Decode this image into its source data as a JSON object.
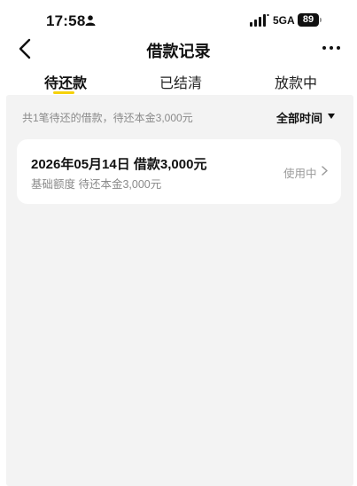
{
  "status_bar": {
    "time": "17:58",
    "network": "5GA",
    "battery": "89"
  },
  "header": {
    "title": "借款记录"
  },
  "tabs": [
    {
      "label": "待还款",
      "active": true
    },
    {
      "label": "已结清",
      "active": false
    },
    {
      "label": "放款中",
      "active": false
    }
  ],
  "summary": {
    "text": "共1笔待还的借款，待还本金3,000元",
    "filter_label": "全部时间"
  },
  "loans": [
    {
      "title": "2026年05月14日 借款3,000元",
      "subtitle": "基础额度 待还本金3,000元",
      "status": "使用中"
    }
  ],
  "colors": {
    "accent": "#f5d10a",
    "background": "#f3f3f3"
  }
}
